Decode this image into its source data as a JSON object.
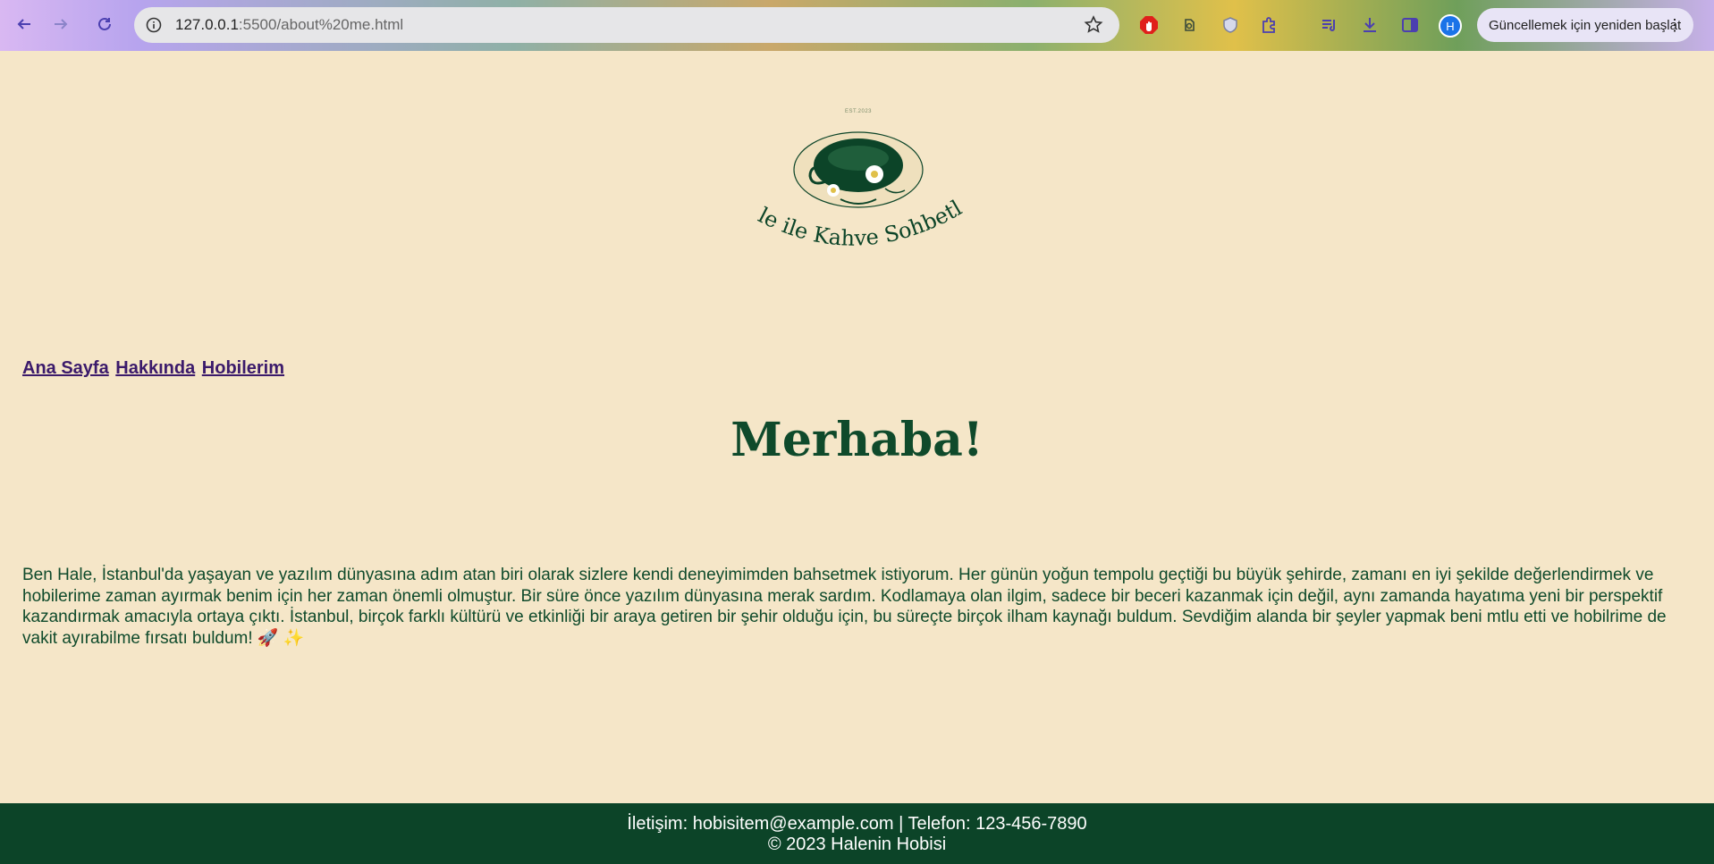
{
  "browser": {
    "url_host": "127.0.0.1",
    "url_path": ":5500/about%20me.html",
    "avatar_letter": "H",
    "update_label": "Güncellemek için yeniden başlat"
  },
  "logo": {
    "est": "EST.2023",
    "brand": "Hale ile Kahve Sohbetleri"
  },
  "nav": {
    "items": [
      "Ana Sayfa",
      "Hakkında",
      "Hobilerim"
    ]
  },
  "main": {
    "heading": "Merhaba!",
    "paragraph": "Ben Hale, İstanbul'da yaşayan ve yazılım dünyasına adım atan biri olarak sizlere kendi deneyimimden bahsetmek istiyorum. Her günün yoğun tempolu geçtiği bu büyük şehirde, zamanı en iyi şekilde değerlendirmek ve hobilerime zaman ayırmak benim için her zaman önemli olmuştur. Bir süre önce yazılım dünyasına merak sardım. Kodlamaya olan ilgim, sadece bir beceri kazanmak için değil, aynı zamanda hayatıma yeni bir perspektif kazandırmak amacıyla ortaya çıktı. İstanbul, birçok farklı kültürü ve etkinliği bir araya getiren bir şehir olduğu için, bu süreçte birçok ilham kaynağı buldum. Sevdiğim alanda bir şeyler yapmak beni mtlu etti ve hobilrime de vakit ayırabilme fırsatı buldum! 🚀 ✨"
  },
  "footer": {
    "contact": "İletişim: hobisitem@example.com | Telefon: 123-456-7890",
    "copyright": "© 2023 Halenin Hobisi"
  },
  "colors": {
    "background": "#f5e6c8",
    "accent_green": "#0f4a2b",
    "footer_bg": "#0c4428",
    "link": "#3b1a6b"
  }
}
